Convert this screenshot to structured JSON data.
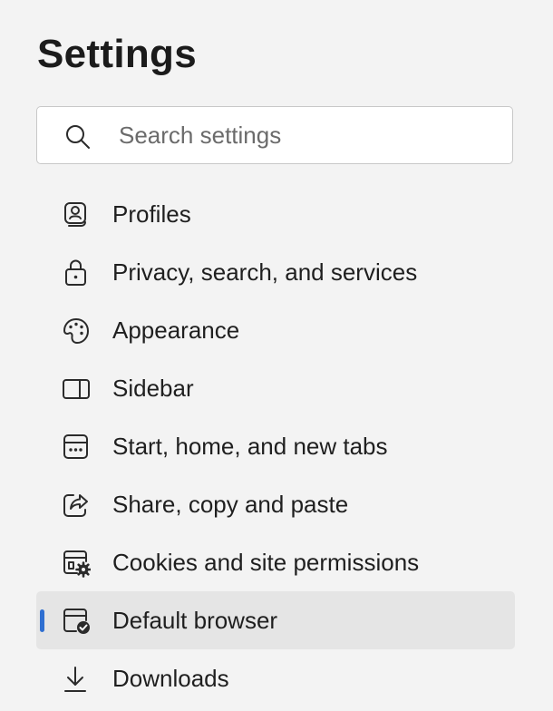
{
  "header": {
    "title": "Settings"
  },
  "search": {
    "placeholder": "Search settings",
    "value": "",
    "icon": "search-icon"
  },
  "nav": {
    "accent_color": "#2f6fd1",
    "selected_index": 7,
    "items": [
      {
        "label": "Profiles",
        "icon": "profile-icon"
      },
      {
        "label": "Privacy, search, and services",
        "icon": "lock-icon"
      },
      {
        "label": "Appearance",
        "icon": "palette-icon"
      },
      {
        "label": "Sidebar",
        "icon": "sidebar-icon"
      },
      {
        "label": "Start, home, and new tabs",
        "icon": "new-tab-icon"
      },
      {
        "label": "Share, copy and paste",
        "icon": "share-icon"
      },
      {
        "label": "Cookies and site permissions",
        "icon": "cookies-permissions-icon"
      },
      {
        "label": "Default browser",
        "icon": "default-browser-icon"
      },
      {
        "label": "Downloads",
        "icon": "download-icon"
      }
    ]
  }
}
